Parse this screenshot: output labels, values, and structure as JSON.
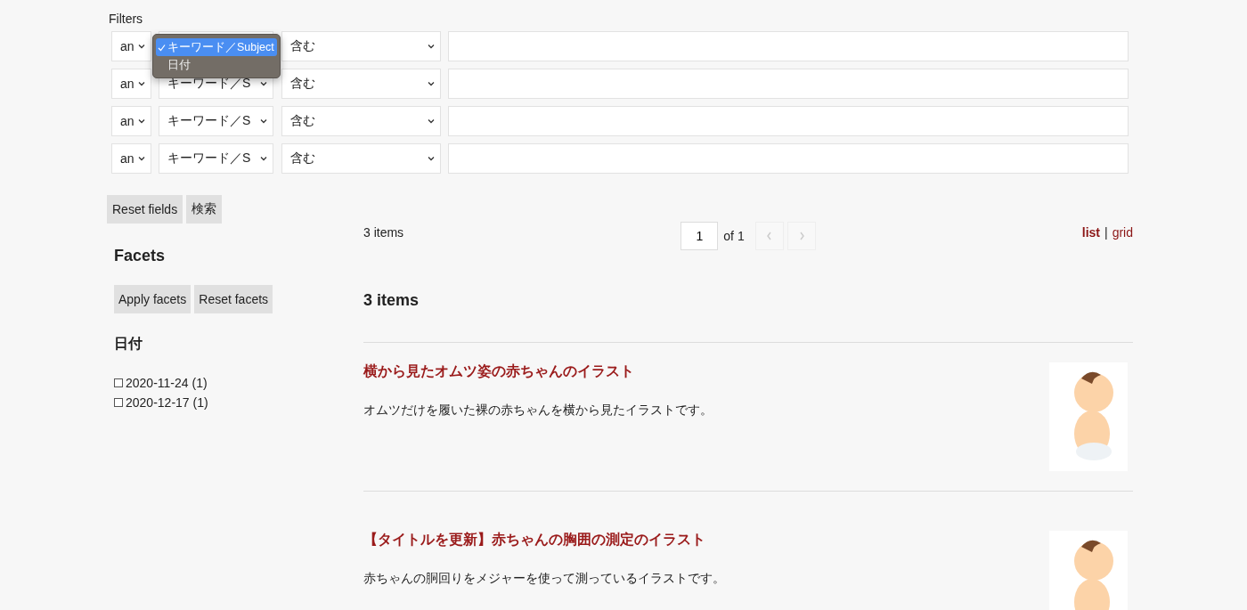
{
  "filters": {
    "label": "Filters",
    "rows": [
      {
        "conjunction": "an",
        "operator": "含む",
        "field_menu": {
          "options": [
            {
              "label": "キーワード／Subject",
              "selected": true
            },
            {
              "label": "日付",
              "selected": false
            }
          ]
        }
      },
      {
        "conjunction": "an",
        "field": "キーワード／S",
        "operator": "含む"
      },
      {
        "conjunction": "an",
        "field": "キーワード／S",
        "operator": "含む"
      },
      {
        "conjunction": "an",
        "field": "キーワード／S",
        "operator": "含む"
      }
    ],
    "buttons": [
      "Reset fields",
      "検索"
    ]
  },
  "facets": {
    "title": "Facets",
    "buttons": [
      "Apply facets",
      "Reset facets"
    ],
    "groups": [
      {
        "title": "日付",
        "items": [
          {
            "label": "2020-11-24 (1)",
            "checked": false
          },
          {
            "label": "2020-12-17 (1)",
            "checked": false
          }
        ]
      }
    ]
  },
  "results": {
    "count": "3 items",
    "pager": {
      "page": "1",
      "of": "of 1",
      "prev": {
        "disabled": true
      },
      "next": {
        "disabled": true
      }
    },
    "views": [
      {
        "label": "list",
        "selected": true
      },
      {
        "label": "grid",
        "selected": false
      }
    ],
    "view_separator": "|",
    "heading": "3 items",
    "items": [
      {
        "title": "横から見たオムツ姿の赤ちゃんのイラスト",
        "description": "オムツだけを履いた裸の赤ちゃんを横から見たイラストです。"
      },
      {
        "title": "【タイトルを更新】赤ちゃんの胸囲の測定のイラスト",
        "description": "赤ちゃんの胴回りをメジャーを使って測っているイラストです。"
      }
    ]
  }
}
